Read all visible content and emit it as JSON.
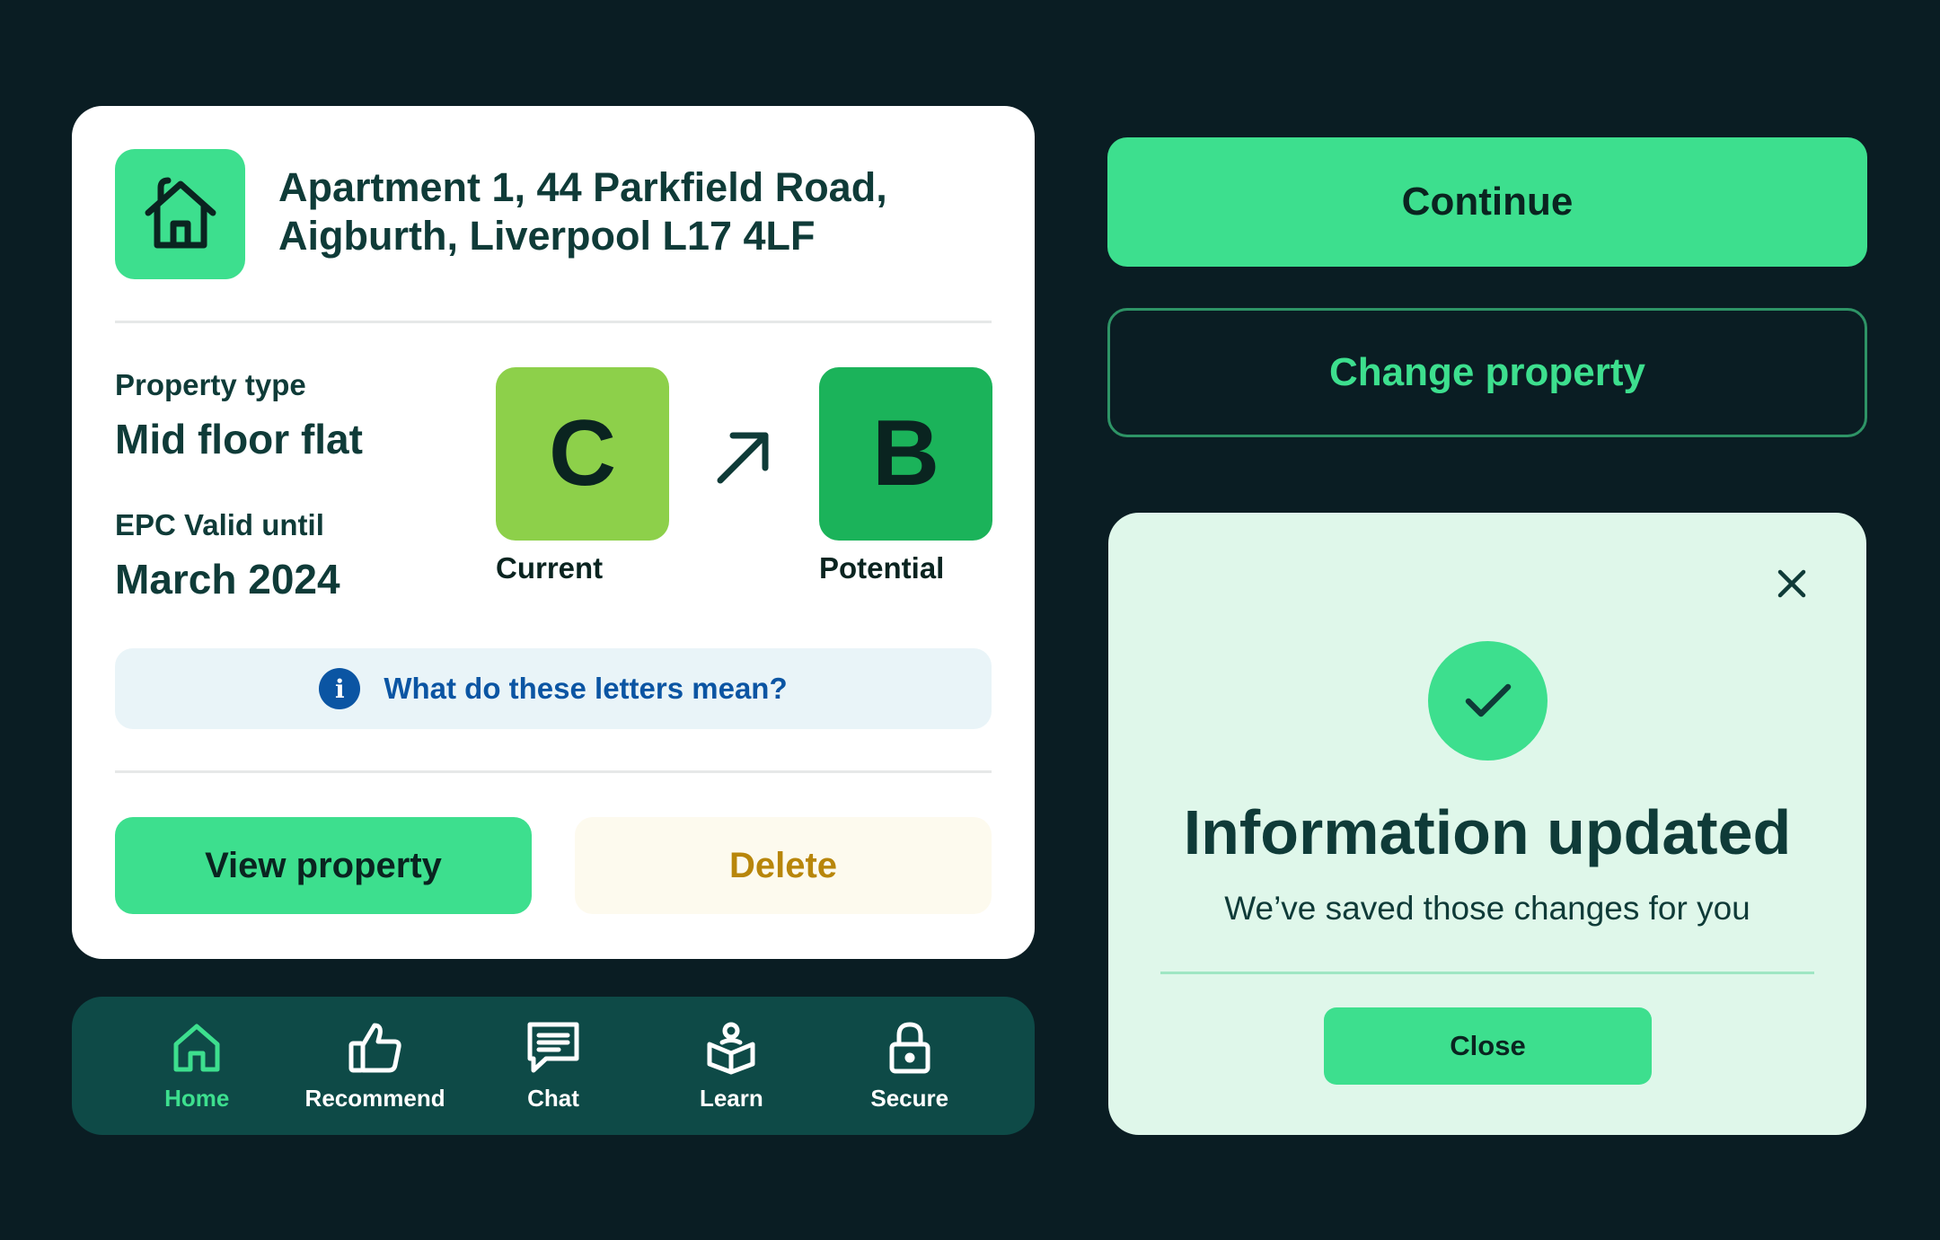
{
  "property": {
    "address_line1": "Apartment 1, 44 Parkfield Road,",
    "address_line2": "Aigburth, Liverpool L17 4LF",
    "icon": "house-icon",
    "type_label": "Property type",
    "type_value": "Mid floor flat",
    "epc_label": "EPC Valid until",
    "epc_value": "March 2024",
    "current_rating": "C",
    "current_label": "Current",
    "potential_rating": "B",
    "potential_label": "Potential",
    "info_text": "What do these letters mean?",
    "view_label": "View property",
    "delete_label": "Delete"
  },
  "nav": {
    "items": [
      {
        "label": "Home",
        "icon": "home-icon",
        "active": true
      },
      {
        "label": "Recommend",
        "icon": "thumbs-up-icon"
      },
      {
        "label": "Chat",
        "icon": "chat-icon"
      },
      {
        "label": "Learn",
        "icon": "book-user-icon"
      },
      {
        "label": "Secure",
        "icon": "lock-icon"
      }
    ]
  },
  "actions": {
    "continue_label": "Continue",
    "change_label": "Change property"
  },
  "modal": {
    "title": "Information updated",
    "subtitle": "We’ve saved those changes for you",
    "close_label": "Close"
  },
  "colors": {
    "background": "#0a1d23",
    "accent": "#3ddf8e",
    "rating_c": "#8dd04a",
    "rating_b": "#1bb35a",
    "info_blue": "#0b55a3",
    "delete_text": "#b8860b",
    "nav_bg": "#0e4a47",
    "modal_bg": "#dff7ea"
  }
}
